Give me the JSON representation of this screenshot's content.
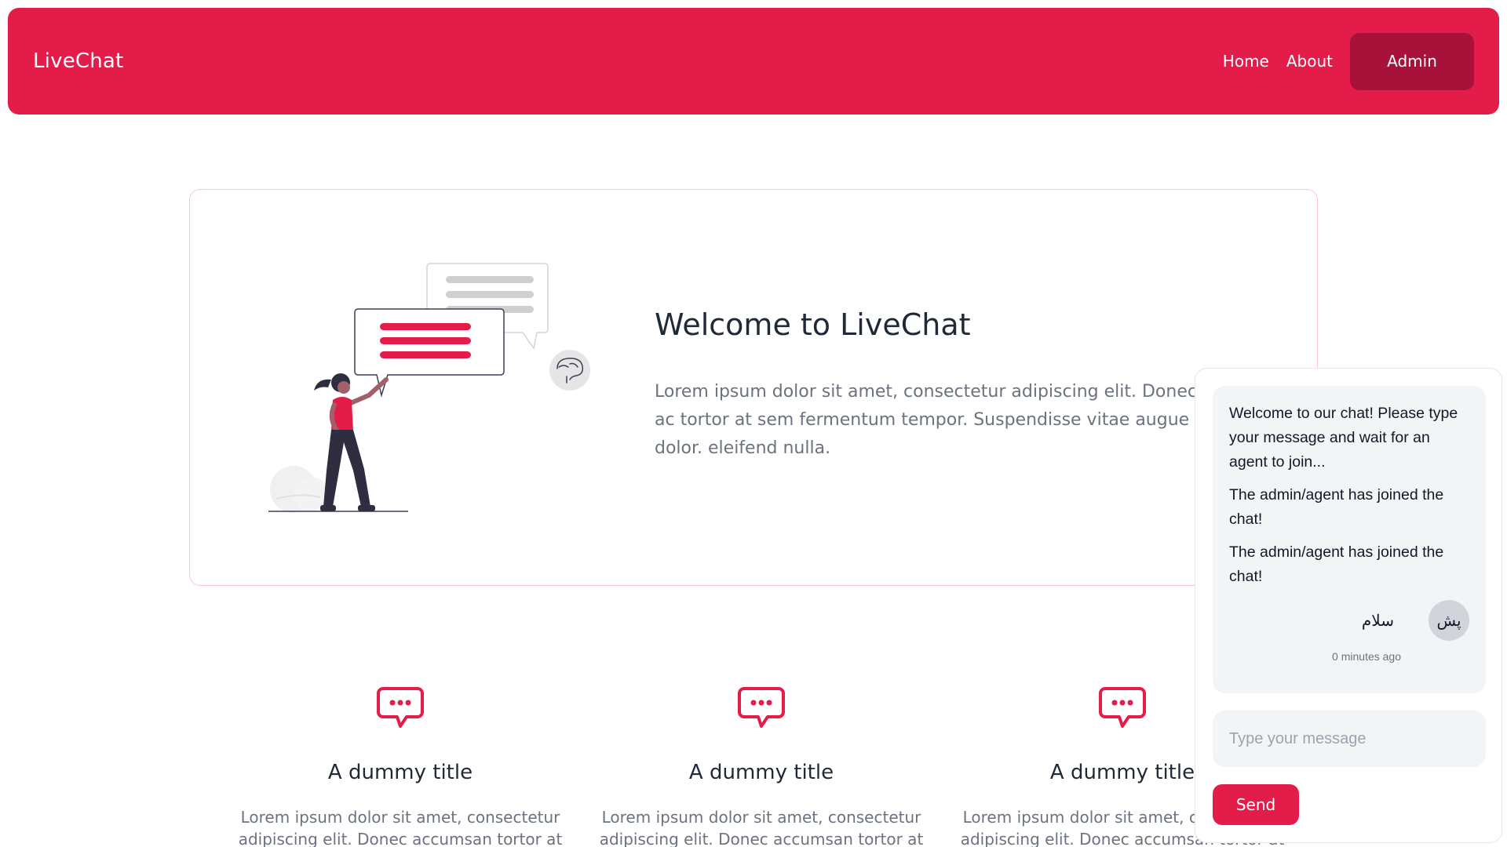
{
  "navbar": {
    "brand": "LiveChat",
    "links": [
      {
        "label": "Home"
      },
      {
        "label": "About"
      }
    ],
    "admin_label": "Admin"
  },
  "hero": {
    "title": "Welcome to LiveChat",
    "text": "Lorem ipsum dolor sit amet, consectetur adipiscing elit. Donec ac tortor at sem fermentum tempor. Suspendisse vitae augue dolor. eleifend nulla."
  },
  "features": [
    {
      "icon": "chat-bubble-icon",
      "title": "A dummy title",
      "text": "Lorem ipsum dolor sit amet, consectetur adipiscing elit. Donec accumsan tortor at sem"
    },
    {
      "icon": "chat-bubble-icon",
      "title": "A dummy title",
      "text": "Lorem ipsum dolor sit amet, consectetur adipiscing elit. Donec accumsan tortor at sem"
    },
    {
      "icon": "chat-bubble-icon",
      "title": "A dummy title",
      "text": "Lorem ipsum dolor sit amet, consectetur adipiscing elit. Donec accumsan tortor at sem"
    }
  ],
  "chat": {
    "messages": [
      "Welcome to our chat! Please type your message and wait for an agent to join...",
      "The admin/agent has joined the chat!",
      "The admin/agent has joined the chat!"
    ],
    "user_message": {
      "text": "سلام",
      "avatar_initials": "پش",
      "time": "0 minutes ago"
    },
    "input_placeholder": "Type your message",
    "send_label": "Send"
  },
  "colors": {
    "brand": "#e31c4a",
    "admin_button": "#a8123a",
    "chat_bg": "#f3f4f6"
  }
}
